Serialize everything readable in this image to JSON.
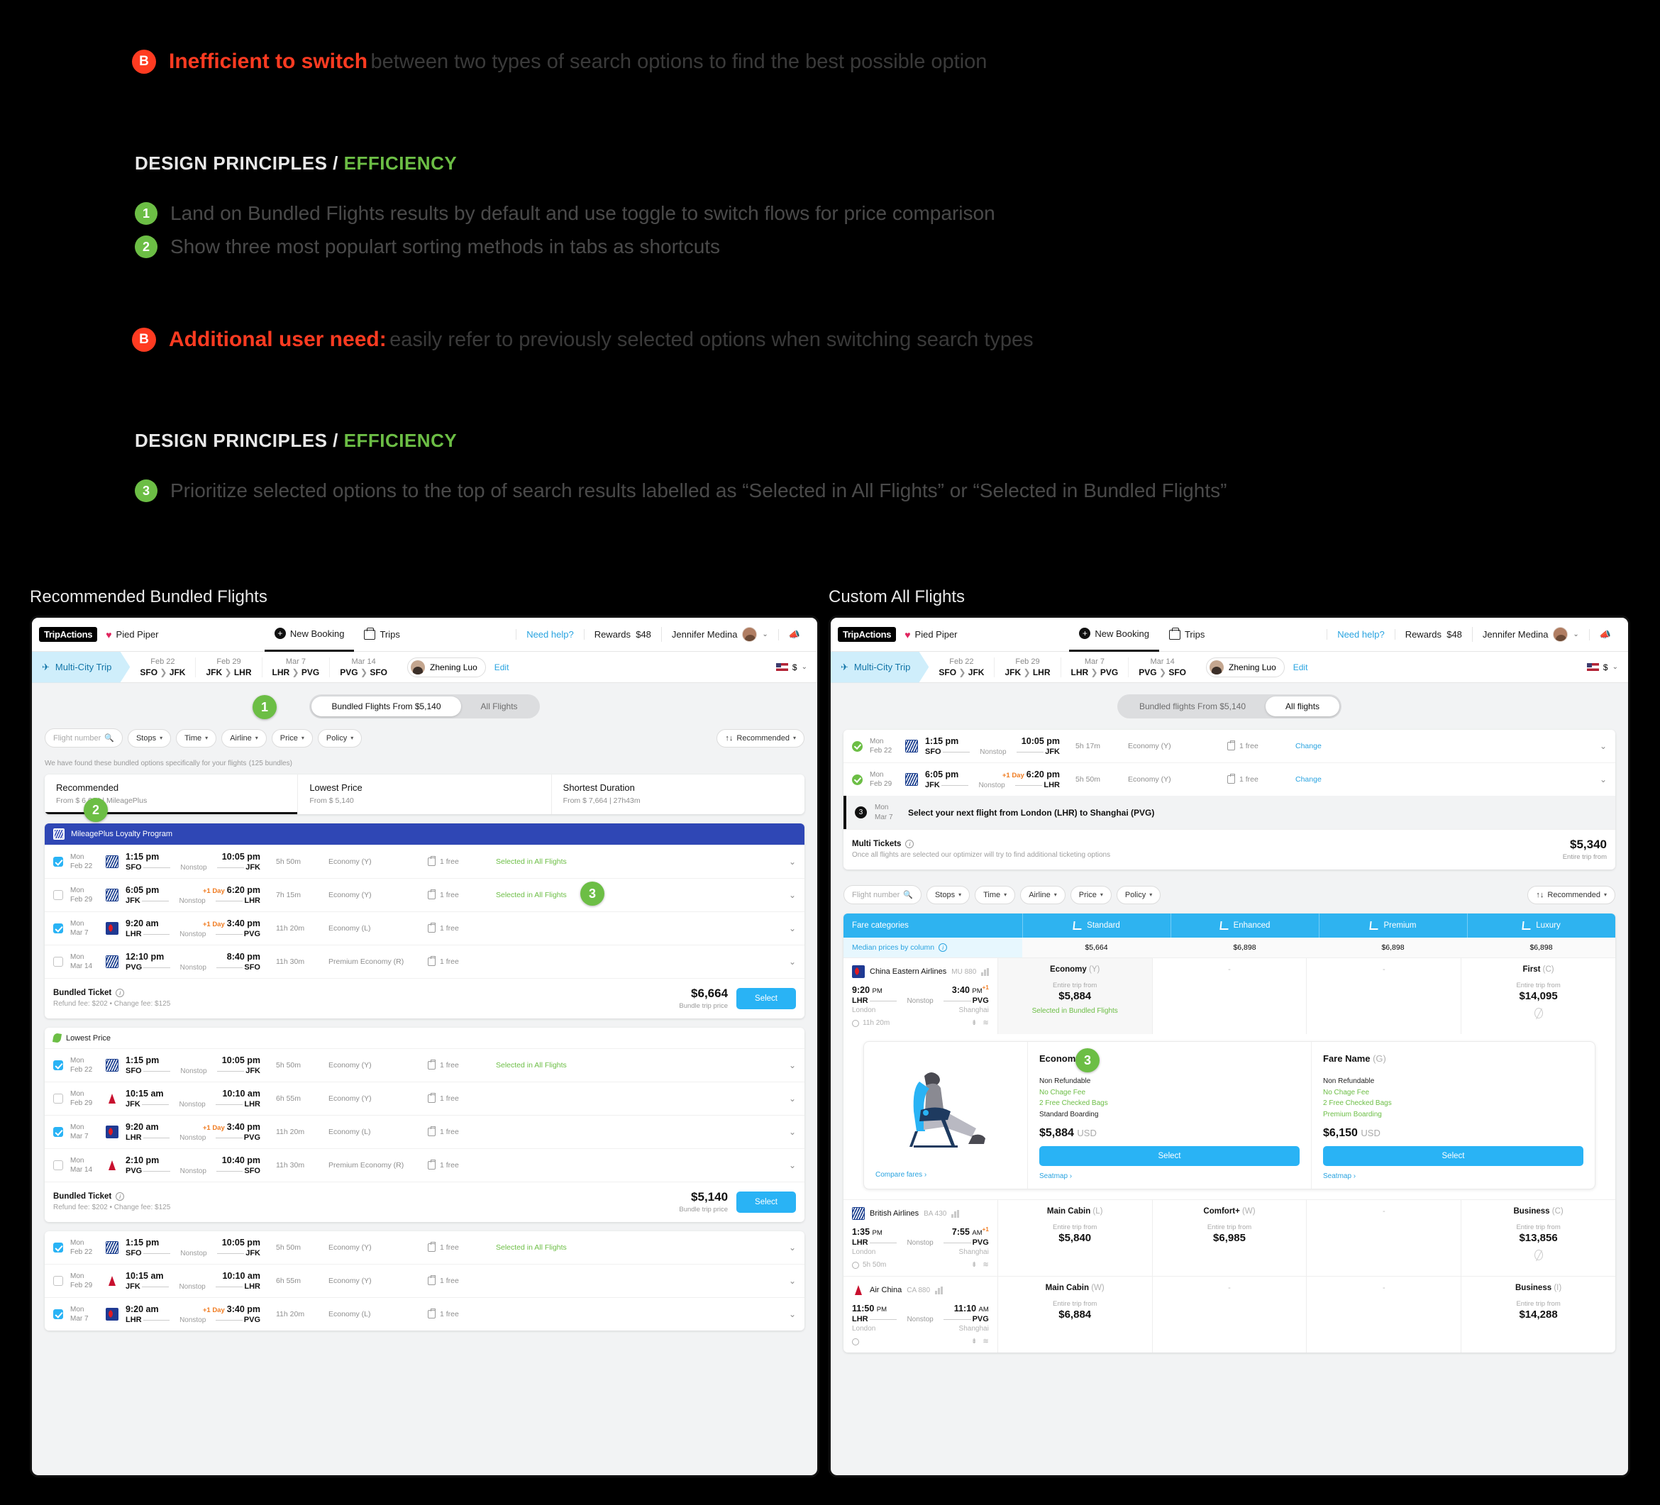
{
  "annotations": {
    "note1": {
      "badge": "B",
      "bold": "Inefficient to switch",
      "rest": "between two types of search options to find the best possible option"
    },
    "principles1": {
      "prefix": "DESIGN PRINCIPLES /",
      "highlight": "EFFICIENCY"
    },
    "items1": [
      {
        "num": "1",
        "text": "Land on Bundled Flights results by default and use toggle to switch flows for price comparison"
      },
      {
        "num": "2",
        "text": "Show three most populart sorting methods in tabs as shortcuts"
      }
    ],
    "note2": {
      "badge": "B",
      "bold": "Additional user need:",
      "rest": "easily refer to previously selected options when switching search types"
    },
    "principles2": {
      "prefix": "DESIGN PRINCIPLES /",
      "highlight": "EFFICIENCY"
    },
    "items2": [
      {
        "num": "3",
        "text": "Prioritize selected options to the top of search results labelled as “Selected in All Flights” or “Selected in Bundled Flights”"
      }
    ],
    "caption_left": "Recommended Bundled Flights",
    "caption_right": "Custom All Flights"
  },
  "chrome": {
    "logo": "TripActions",
    "heart": "♥",
    "company": "Pied Piper",
    "new_booking": "New Booking",
    "trips": "Trips",
    "need_help": "Need help?",
    "rewards_label": "Rewards",
    "rewards_value": "$48",
    "user": "Jennifer Medina",
    "trip_type": "Multi-City Trip",
    "legs": [
      {
        "date": "Feb 22",
        "from": "SFO",
        "to": "JFK"
      },
      {
        "date": "Feb 29",
        "from": "JFK",
        "to": "LHR"
      },
      {
        "date": "Mar 7",
        "from": "LHR",
        "to": "PVG"
      },
      {
        "date": "Mar 14",
        "from": "PVG",
        "to": "SFO"
      }
    ],
    "traveler": "Zhening Luo",
    "edit": "Edit",
    "currency": "$"
  },
  "left": {
    "toggle": {
      "bundled": "Bundled Flights From $5,140",
      "all": "All Flights",
      "active": "bundled"
    },
    "filters": {
      "flight_number_placeholder": "Flight number",
      "stops": "Stops",
      "time": "Time",
      "airline": "Airline",
      "price": "Price",
      "policy": "Policy",
      "sort": "Recommended"
    },
    "found_text": "We have found these bundled options specifically for your flights",
    "found_count": "(125 bundles)",
    "sort_tabs": [
      {
        "title": "Recommended",
        "sub": "From $ 6,664  |  MileagePlus",
        "selected": true
      },
      {
        "title": "Lowest Price",
        "sub": "From $ 5,140",
        "selected": false
      },
      {
        "title": "Shortest Duration",
        "sub": "From $ 7,664  |  27h43m",
        "selected": false
      }
    ],
    "bundles": [
      {
        "banner": "MileagePlus Loyalty Program",
        "banner_type": "blue",
        "rows": [
          {
            "checked": true,
            "day": "Mon",
            "date": "Feb 22",
            "airline": "united",
            "dep": "1:15 pm",
            "arr": "10:05 pm",
            "plusday": "",
            "from": "SFO",
            "to": "JFK",
            "stops": "Nonstop",
            "dur": "5h 50m",
            "cabin": "Economy (Y)",
            "bag": "1 free",
            "note": "Selected in All Flights"
          },
          {
            "checked": false,
            "day": "Mon",
            "date": "Feb 29",
            "airline": "united",
            "dep": "6:05 pm",
            "arr": "6:20 pm",
            "plusday": "+1 Day",
            "from": "JFK",
            "to": "LHR",
            "stops": "Nonstop",
            "dur": "7h 15m",
            "cabin": "Economy (Y)",
            "bag": "1 free",
            "note": "Selected in All Flights"
          },
          {
            "checked": true,
            "day": "Mon",
            "date": "Mar 7",
            "airline": "ce",
            "dep": "9:20 am",
            "arr": "3:40 pm",
            "plusday": "+1 Day",
            "from": "LHR",
            "to": "PVG",
            "stops": "Nonstop",
            "dur": "11h 20m",
            "cabin": "Economy (L)",
            "bag": "1 free",
            "note": ""
          },
          {
            "checked": false,
            "day": "Mon",
            "date": "Mar 14",
            "airline": "united",
            "dep": "12:10 pm",
            "arr": "8:40 pm",
            "plusday": "",
            "from": "PVG",
            "to": "SFO",
            "stops": "Nonstop",
            "dur": "11h 30m",
            "cabin": "Premium Economy (R)",
            "bag": "1 free",
            "note": ""
          }
        ],
        "foot": {
          "label": "Bundled Ticket",
          "fees": "Refund fee: $202 • Change fee: $125",
          "price": "$6,664",
          "price_sub": "Bundle trip price",
          "button": "Select"
        }
      },
      {
        "banner": "Lowest Price",
        "banner_type": "leaf",
        "rows": [
          {
            "checked": true,
            "day": "Mon",
            "date": "Feb 22",
            "airline": "united",
            "dep": "1:15 pm",
            "arr": "10:05 pm",
            "plusday": "",
            "from": "SFO",
            "to": "JFK",
            "stops": "Nonstop",
            "dur": "5h 50m",
            "cabin": "Economy (Y)",
            "bag": "1 free",
            "note": "Selected in All Flights"
          },
          {
            "checked": false,
            "day": "Mon",
            "date": "Feb 29",
            "airline": "delta",
            "dep": "10:15 am",
            "arr": "10:10 am",
            "plusday": "",
            "from": "JFK",
            "to": "LHR",
            "stops": "Nonstop",
            "dur": "6h 55m",
            "cabin": "Economy (Y)",
            "bag": "1 free",
            "note": ""
          },
          {
            "checked": true,
            "day": "Mon",
            "date": "Mar 7",
            "airline": "ce",
            "dep": "9:20 am",
            "arr": "3:40 pm",
            "plusday": "+1 Day",
            "from": "LHR",
            "to": "PVG",
            "stops": "Nonstop",
            "dur": "11h 20m",
            "cabin": "Economy (L)",
            "bag": "1 free",
            "note": ""
          },
          {
            "checked": false,
            "day": "Mon",
            "date": "Mar 14",
            "airline": "delta",
            "dep": "2:10 pm",
            "arr": "10:40 pm",
            "plusday": "",
            "from": "PVG",
            "to": "SFO",
            "stops": "Nonstop",
            "dur": "11h 30m",
            "cabin": "Premium Economy (R)",
            "bag": "1 free",
            "note": ""
          }
        ],
        "foot": {
          "label": "Bundled Ticket",
          "fees": "Refund fee: $202 • Change fee: $125",
          "price": "$5,140",
          "price_sub": "Bundle trip price",
          "button": "Select"
        }
      },
      {
        "banner": "",
        "banner_type": "none",
        "rows": [
          {
            "checked": true,
            "day": "Mon",
            "date": "Feb 22",
            "airline": "united",
            "dep": "1:15 pm",
            "arr": "10:05 pm",
            "plusday": "",
            "from": "SFO",
            "to": "JFK",
            "stops": "Nonstop",
            "dur": "5h 50m",
            "cabin": "Economy (Y)",
            "bag": "1 free",
            "note": "Selected in All Flights"
          },
          {
            "checked": false,
            "day": "Mon",
            "date": "Feb 29",
            "airline": "delta",
            "dep": "10:15 am",
            "arr": "10:10 am",
            "plusday": "",
            "from": "JFK",
            "to": "LHR",
            "stops": "Nonstop",
            "dur": "6h 55m",
            "cabin": "Economy (Y)",
            "bag": "1 free",
            "note": ""
          },
          {
            "checked": true,
            "day": "Mon",
            "date": "Mar 7",
            "airline": "ce",
            "dep": "9:20 am",
            "arr": "3:40 pm",
            "plusday": "+1 Day",
            "from": "LHR",
            "to": "PVG",
            "stops": "Nonstop",
            "dur": "11h 20m",
            "cabin": "Economy (L)",
            "bag": "1 free",
            "note": ""
          }
        ],
        "foot": null
      }
    ]
  },
  "right": {
    "toggle": {
      "bundled": "Bundled flights From $5,140",
      "all": "All flights",
      "active": "all"
    },
    "selected_rows": [
      {
        "day": "Mon",
        "date": "Feb 22",
        "airline": "united",
        "dep": "1:15 pm",
        "arr": "10:05 pm",
        "plusday": "",
        "from": "SFO",
        "to": "JFK",
        "stops": "Nonstop",
        "dur": "5h 17m",
        "cabin": "Economy (Y)",
        "bag": "1 free",
        "action": "Change"
      },
      {
        "day": "Mon",
        "date": "Feb 29",
        "airline": "united",
        "dep": "6:05 pm",
        "arr": "6:20 pm",
        "plusday": "+1 Day",
        "from": "JFK",
        "to": "LHR",
        "stops": "Nonstop",
        "dur": "5h 50m",
        "cabin": "Economy (Y)",
        "bag": "1 free",
        "action": "Change"
      }
    ],
    "next_leg": {
      "num": "3",
      "day": "Mon",
      "date": "Mar 7",
      "text": "Select your next flight from London (LHR) to Shanghai (PVG)"
    },
    "multi_tickets": {
      "label": "Multi Tickets",
      "desc": "Once all flights are selected our optimizer will try to find additional ticketing options",
      "price": "$5,340",
      "price_sub": "Entire trip from"
    },
    "filters": {
      "flight_number_placeholder": "Flight number",
      "stops": "Stops",
      "time": "Time",
      "airline": "Airline",
      "price": "Price",
      "policy": "Policy",
      "sort": "Recommended"
    },
    "fare_table": {
      "header": [
        "Fare categories",
        "Standard",
        "Enhanced",
        "Premium",
        "Luxury"
      ],
      "median_label": "Median prices by column",
      "median_values": [
        "$5,664",
        "$6,898",
        "$6,898",
        "$6,898"
      ],
      "rows": [
        {
          "airline": "China Eastern Airlines",
          "flight_no": "MU 880",
          "logo": "ce",
          "dep": "9:20",
          "dep_ampm": "PM",
          "arr": "3:40",
          "arr_ampm": "PM",
          "plus": "+1",
          "from": "LHR",
          "to": "PVG",
          "from_city": "London",
          "to_city": "Shanghai",
          "stops": "Nonstop",
          "dur": "11h 20m",
          "cells": [
            {
              "cabin": "Economy",
              "code": "(Y)",
              "from": "Entire trip from",
              "price": "$5,884",
              "note": "Selected in Bundled Flights",
              "highlight": true
            },
            {
              "dash": true
            },
            {
              "dash": true
            },
            {
              "cabin": "First",
              "code": "(C)",
              "from": "Entire trip from",
              "price": "$14,095",
              "nonref": true
            }
          ]
        },
        {
          "airline": "British Airlines",
          "flight_no": "BA 430",
          "logo": "ba",
          "dep": "1:35",
          "dep_ampm": "PM",
          "arr": "7:55",
          "arr_ampm": "AM",
          "plus": "+1",
          "from": "LHR",
          "to": "PVG",
          "from_city": "London",
          "to_city": "Shanghai",
          "stops": "Nonstop",
          "dur": "5h 50m",
          "cells": [
            {
              "cabin": "Main Cabin",
              "code": "(L)",
              "from": "Entire trip from",
              "price": "$5,840"
            },
            {
              "cabin": "Comfort+",
              "code": "(W)",
              "from": "Entire trip from",
              "price": "$6,985"
            },
            {
              "dash": true
            },
            {
              "cabin": "Business",
              "code": "(C)",
              "from": "Entire trip from",
              "price": "$13,856",
              "nonref": true
            }
          ]
        },
        {
          "airline": "Air China",
          "flight_no": "CA 880",
          "logo": "ca",
          "dep": "11:50",
          "dep_ampm": "PM",
          "arr": "11:10",
          "arr_ampm": "AM",
          "plus": "",
          "from": "LHR",
          "to": "PVG",
          "from_city": "London",
          "to_city": "Shanghai",
          "stops": "Nonstop",
          "dur": "",
          "cells": [
            {
              "cabin": "Main Cabin",
              "code": "(W)",
              "from": "Entire trip from",
              "price": "$6,884"
            },
            {
              "dash": true
            },
            {
              "dash": true
            },
            {
              "cabin": "Business",
              "code": "(I)",
              "from": "Entire trip from",
              "price": "$14,288"
            }
          ]
        }
      ]
    },
    "fare_detail": {
      "compare_link": "Compare fares ›",
      "columns": [
        {
          "title": "Economy",
          "code": "(Y)",
          "features": [
            {
              "text": "Non Refundable",
              "green": false
            },
            {
              "text": "No Chage Fee",
              "green": true
            },
            {
              "text": "2 Free Checked Bags",
              "green": true
            },
            {
              "text": "Standard Boarding",
              "green": false
            }
          ],
          "price": "$5,884",
          "currency": "USD",
          "button": "Select",
          "link": "Seatmap ›"
        },
        {
          "title": "Fare Name",
          "code": "(G)",
          "features": [
            {
              "text": "Non Refundable",
              "green": false
            },
            {
              "text": "No Chage Fee",
              "green": true
            },
            {
              "text": "2 Free Checked Bags",
              "green": true
            },
            {
              "text": "Premium Boarding",
              "green": true
            }
          ],
          "price": "$6,150",
          "currency": "USD",
          "button": "Select",
          "link": "Seatmap ›"
        }
      ]
    }
  },
  "markers": {
    "left_1": "1",
    "left_2": "2",
    "left_3": "3",
    "right_3": "3"
  },
  "colors": {
    "accent_blue": "#29b3f5",
    "green": "#6cbe45",
    "red": "#ff3b21",
    "header_blue": "#2eb3f0",
    "bundle_blue": "#2f47b5"
  }
}
